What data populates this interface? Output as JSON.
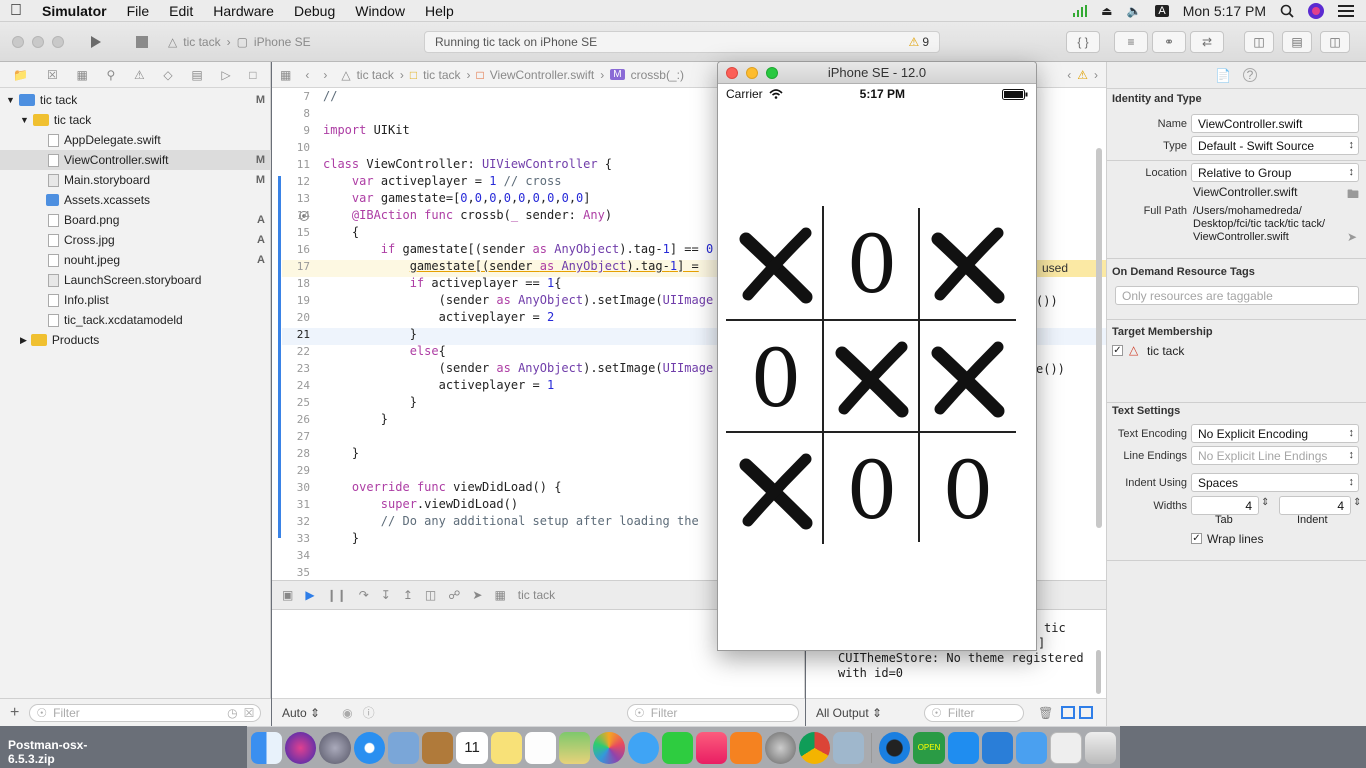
{
  "menubar": {
    "app": "Simulator",
    "items": [
      "File",
      "Edit",
      "Hardware",
      "Debug",
      "Window",
      "Help"
    ],
    "clock": "Mon 5:17 PM"
  },
  "toolbar": {
    "scheme_target": "tic tack",
    "scheme_device": "iPhone SE",
    "activity": "Running tic tack on iPhone SE",
    "warning_count": "9"
  },
  "navigator": {
    "items": [
      {
        "label": "tic tack",
        "badge": "M"
      },
      {
        "label": "tic tack",
        "badge": ""
      },
      {
        "label": "AppDelegate.swift",
        "badge": ""
      },
      {
        "label": "ViewController.swift",
        "badge": "M"
      },
      {
        "label": "Main.storyboard",
        "badge": "M"
      },
      {
        "label": "Assets.xcassets",
        "badge": ""
      },
      {
        "label": "Board.png",
        "badge": "A"
      },
      {
        "label": "Cross.jpg",
        "badge": "A"
      },
      {
        "label": "nouht.jpeg",
        "badge": "A"
      },
      {
        "label": "LaunchScreen.storyboard",
        "badge": ""
      },
      {
        "label": "Info.plist",
        "badge": ""
      },
      {
        "label": "tic_tack.xcdatamodeld",
        "badge": ""
      },
      {
        "label": "Products",
        "badge": ""
      }
    ],
    "filter_placeholder": "Filter"
  },
  "jumpbar": {
    "crumbs": [
      "tic tack",
      "tic tack",
      "ViewController.swift",
      "crossb(_:)"
    ]
  },
  "editor": {
    "line_numbers": [
      "7",
      "8",
      "9",
      "10",
      "11",
      "12",
      "13",
      "14",
      "15",
      "16",
      "17",
      "18",
      "19",
      "20",
      "21",
      "22",
      "23",
      "24",
      "25",
      "26",
      "27",
      "28",
      "29",
      "30",
      "31",
      "32",
      "33",
      "34",
      "35"
    ],
    "inline_issue": "used",
    "trailing_fragments": {
      "line19": "())",
      "line23": "e())"
    }
  },
  "debug": {
    "process": "tic tack",
    "auto_label": "Auto",
    "filter_placeholder": "Filter",
    "output_label": "All Output",
    "console_lines": [
      "tic",
      "]",
      "CUIThemeStore: No theme registered",
      "with id=0"
    ]
  },
  "inspector": {
    "identity_header": "Identity and Type",
    "name_label": "Name",
    "name_value": "ViewController.swift",
    "type_label": "Type",
    "type_value": "Default - Swift Source",
    "location_label": "Location",
    "location_value": "Relative to Group",
    "location_file": "ViewController.swift",
    "fullpath_label": "Full Path",
    "fullpath_1": "/Users/mohamedreda/",
    "fullpath_2": "Desktop/fci/tic tack/tic tack/",
    "fullpath_3": "ViewController.swift",
    "tags_header": "On Demand Resource Tags",
    "tags_placeholder": "Only resources are taggable",
    "target_header": "Target Membership",
    "target_name": "tic tack",
    "text_header": "Text Settings",
    "encoding_label": "Text Encoding",
    "encoding_value": "No Explicit Encoding",
    "endings_label": "Line Endings",
    "endings_value": "No Explicit Line Endings",
    "indent_label": "Indent Using",
    "indent_value": "Spaces",
    "widths_label": "Widths",
    "tab_value": "4",
    "indent_width_value": "4",
    "tab_caption": "Tab",
    "indent_caption": "Indent",
    "wrap_label": "Wrap lines"
  },
  "simulator": {
    "title": "iPhone SE - 12.0",
    "carrier": "Carrier",
    "time": "5:17 PM",
    "board": [
      "X",
      "O",
      "X",
      "O",
      "X",
      "X",
      "X",
      "O",
      "O"
    ],
    "o_glyph": "0"
  },
  "desktop": {
    "file_label": "Postman-osx-6.5.3.zip"
  }
}
